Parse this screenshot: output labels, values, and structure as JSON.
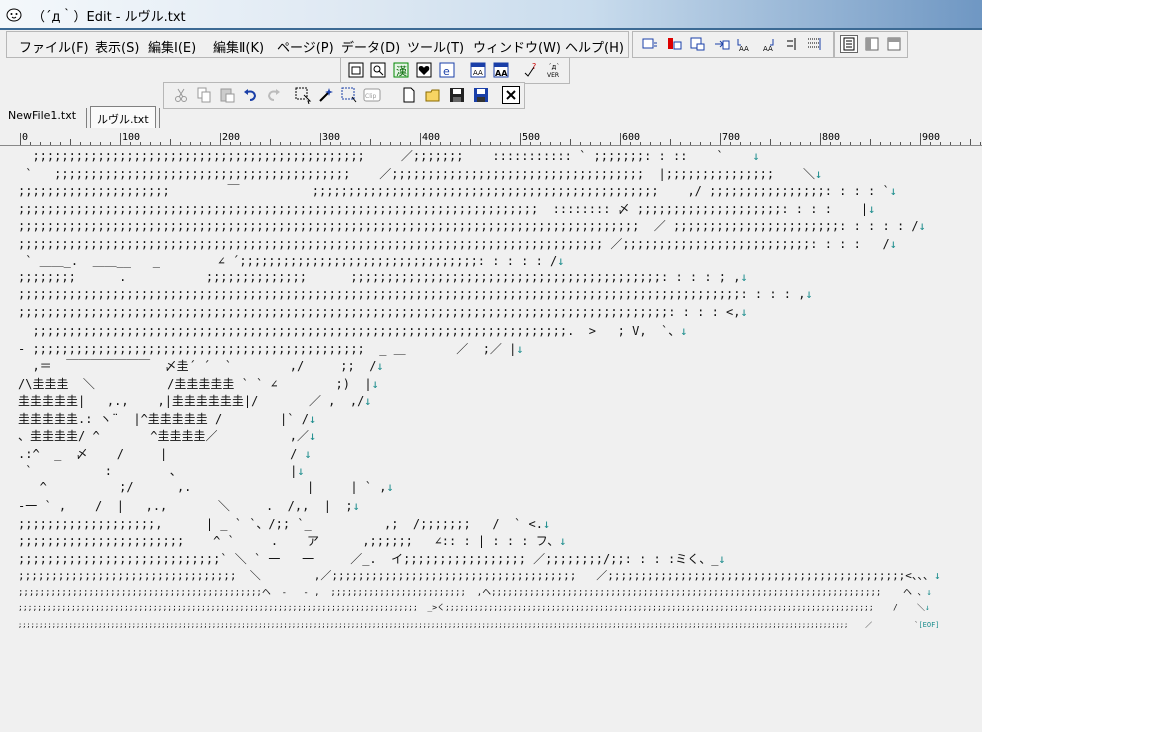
{
  "window": {
    "title": "（´д｀）Edit - ルヴル.txt"
  },
  "menu": [
    {
      "label": "ファイル(F)"
    },
    {
      "label": "表示(S)"
    },
    {
      "label": "編集Ⅰ(E)"
    },
    {
      "label": "編集Ⅱ(K)"
    },
    {
      "label": "ページ(P)"
    },
    {
      "label": "データ(D)"
    },
    {
      "label": "ツール(T)"
    },
    {
      "label": "ウィンドウ(W)"
    },
    {
      "label": "ヘルプ(H)"
    }
  ],
  "toolbar_view_icons": [
    "page-view-icon",
    "preview-icon",
    "kanji-icon",
    "heart-icon",
    "browser-icon",
    "aa-list-icon",
    "aa-template-icon",
    "check-icon",
    "version-icon"
  ],
  "toolbar_edit_icons": [
    "cut-icon",
    "copy-icon",
    "paste-icon",
    "undo-icon",
    "redo-icon",
    "select-icon",
    "magic-select-icon",
    "rect-select-icon",
    "clip-icon",
    "new-file-icon",
    "open-folder-icon",
    "save-icon",
    "save-as-icon",
    "close-icon"
  ],
  "tabs": {
    "tab1": "NewFile1.txt",
    "tab2": "ルヴル.txt"
  },
  "ruler": {
    "labels": [
      "0",
      "100",
      "200",
      "300",
      "400",
      "500",
      "600",
      "700",
      "800",
      "900"
    ]
  },
  "document": {
    "lines": [
      "  ;;;;;;;;;;;;;;;;;;;;;;;;;;;;;;;;;;;;;;;;;;;;;;     ／;;;;;;;    ::::::::::: ` ;;;;;;;: : ::    `    ",
      " `   ;;;;;;;;;;;;;;;;;;;;;;;;;;;;;;;;;;;;;;;;;    ／;;;;;;;;;;;;;;;;;;;;;;;;;;;;;;;;;;;  |;;;;;;;;;;;;;;;    ＼",
      ";;;;;;;;;;;;;;;;;;;;;        ￣          ;;;;;;;;;;;;;;;;;;;;;;;;;;;;;;;;;;;;;;;;;;;;;;;;    ,/ ;;;;;;;;;;;;;;;;: : : : `",
      ";;;;;;;;;;;;;;;;;;;;;;;;;;;;;;;;;;;;;;;;;;;;;;;;;;;;;;;;;;;;;;;;;;;;;;;;  :::::::: 〆 ;;;;;;;;;;;;;;;;;;;;: : : :    |",
      ";;;;;;;;;;;;;;;;;;;;;;;;;;;;;;;;;;;;;;;;;;;;;;;;;;;;;;;;;;;;;;;;;;;;;;;;;;;;;;;;;;;;;;  ／ ;;;;;;;;;;;;;;;;;;;;;;;: : : : : /",
      ";;;;;;;;;;;;;;;;;;;;;;;;;;;;;;;;;;;;;;;;;;;;;;;;;;;;;;;;;;;;;;;;;;;;;;;;;;;;;;;;; ／;;;;;;;;;;;;;;;;;;;;;;;;;;: : : :   /",
      " ` ＿＿_.  ＿＿__   _        ∠ ´;;;;;;;;;;;;;;;;;;;;;;;;;;;;;;;;;: : : : : /",
      ";;;;;;;;      .           ;;;;;;;;;;;;;;      ;;;;;;;;;;;;;;;;;;;;;;;;;;;;;;;;;;;;;;;;;;;: : : : ; ,",
      ";;;;;;;;;;;;;;;;;;;;;;;;;;;;;;;;;;;;;;;;;;;;;;;;;;;;;;;;;;;;;;;;;;;;;;;;;;;;;;;;;;;;;;;;;;;;;;;;;;;;: : : : ,",
      ";;;;;;;;;;;;;;;;;;;;;;;;;;;;;;;;;;;;;;;;;;;;;;;;;;;;;;;;;;;;;;;;;;;;;;;;;;;;;;;;;;;;;;;;;;: : : : <,",
      "  ;;;;;;;;;;;;;;;;;;;;;;;;;;;;;;;;;;;;;;;;;;;;;;;;;;;;;;;;;;;;;;;;;;;;;;;;;;.  >   ; V,  `、",
      "- ;;;;;;;;;;;;;;;;;;;;;;;;;;;;;;;;;;;;;;;;;;;;;;  _ ＿       ／  ;／ |",
      "  ,＝  ￣￣￣￣￣￣￣  〆圭´ ´  `        ,/     ;;  /",
      "/\\圭圭圭  ＼          /圭圭圭圭圭 ` ` ∠        ;)  |",
      "圭圭圭圭圭|   ,.,    ,|圭圭圭圭圭圭|/       ／ ,  ,/",
      "圭圭圭圭圭.: ヽ¨  |^圭圭圭圭圭 /        |` /",
      "、圭圭圭圭/ ^       ^圭圭圭圭／          ,／",
      ".:^  _  〆    /     |                 / ",
      " `          :        、               |",
      "   ^          ;/      ,.                |     | ` ,",
      "-一 ` ,    /  |   ,.,       ＼     .  /,,  |  ;",
      ";;;;;;;;;;;;;;;;;;;,      | _ ` `、/;; `_          ,;  /;;;;;;;   /  ` <.",
      ";;;;;;;;;;;;;;;;;;;;;;;    ^ `     .    ア      ,;;;;;;   ∠:: : | : : : フ、",
      ";;;;;;;;;;;;;;;;;;;;;;;;;;;;` ＼ ` 一   一     ／_.  イ;;;;;;;;;;;;;;;;; ／;;;;;;;;/;;: : : :ミく、_",
      ";;;;;;;;;;;;;;;;;;;;;;;;;;;;;;;;;  ＼        ,／;;;;;;;;;;;;;;;;;;;;;;;;;;;;;;;;;;;;;   ／;;;;;;;;;;;;;;;;;;;;;;;;;;;;;;;;;;;;;;;;;;;;;<、、、",
      ";;;;;;;;;;;;;;;;;;;;;;;;;;;;;;;;;;;;;;;;;;;;;ヘ  -   - ,  ;;;;;;;;;;;;;;;;;;;;;;;;;  ,ヘ;;;;;;;;;;;;;;;;;;;;;;;;;;;;;;;;;;;;;;;;;;;;;;;;;;;;;;;;;;;;;;;;;;;;;;;;    ヘ 、",
      ";;;;;;;;;;;;;;;;;;;;;;;;;;;;;;;;;;;;;;;;;;;;;;;;;;;;;;;;;;;;;;;;;;;;;;;;;;;;;;;;;;;  _>く;;;;;;;;;;;;;;;;;;;;;;;;;;;;;;;;;;;;;;;;;;;;;;;;;;;;;;;;;;;;;;;;;;;;;;;;;;;;;;;;;;;;;;;;;    /    ＼",
      ";;;;;;;;;;;;;;;;;;;;;;;;;;;;;;;;;;;;;;;;;;;;;;;;;;;;;;;;;;;;;;;;;;;;;;;;;;;;;;;;;;;;;;;;;;;;;;;;;;;;;;;;;;;;;;;;;;;;;;;;;;;;;;;;;;;;;;;;;;;;;;;;;;;;;;;;;;;;;;;;;;;;;;;;;;;;;;;;;;;;;;;;;;;;;;;;;;;;;    ／          `"
    ],
    "end_marker": "↓",
    "eof_marker": "[EOF]"
  }
}
